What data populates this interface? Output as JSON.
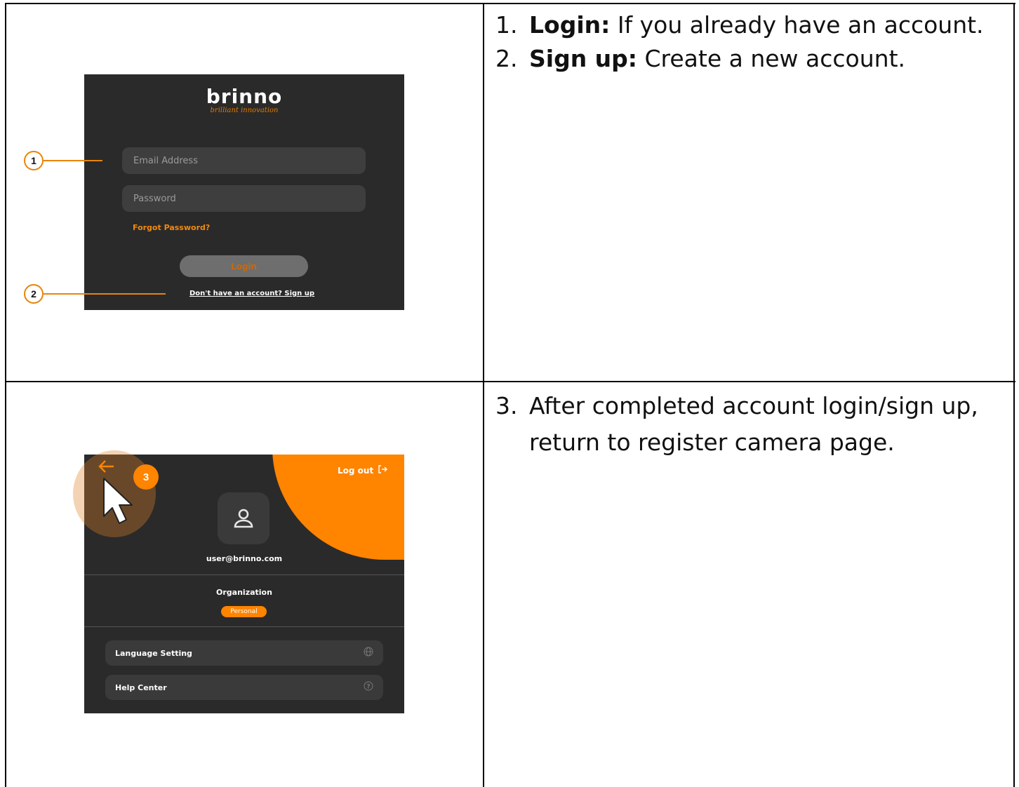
{
  "steps": [
    {
      "num": "1.",
      "bold": "Login:",
      "text": " If you already have an account."
    },
    {
      "num": "2.",
      "bold": "Sign up:",
      "text": " Create a new account."
    },
    {
      "num": "3.",
      "line1": "After completed account login/sign up,",
      "line2": "return to register camera page."
    }
  ],
  "login_screen": {
    "logo_word": "brinno",
    "logo_tagline": "brilliant innovation",
    "email_placeholder": "Email Address",
    "password_placeholder": "Password",
    "forgot_label": "Forgot Password?",
    "login_label": "Login",
    "signup_label": "Don't have an account? Sign up",
    "callouts": [
      "1",
      "2"
    ]
  },
  "profile_screen": {
    "back_icon": "arrow-left-icon",
    "badge": "3",
    "logout_label": "Log out",
    "user_email": "user@brinno.com",
    "org_label": "Organization",
    "org_value": "Personal",
    "menu": [
      {
        "label": "Language Setting",
        "icon": "globe-icon"
      },
      {
        "label": "Help Center",
        "icon": "help-icon"
      }
    ]
  },
  "colors": {
    "accent": "#ff8400",
    "panel_bg": "#2a2a2a"
  }
}
